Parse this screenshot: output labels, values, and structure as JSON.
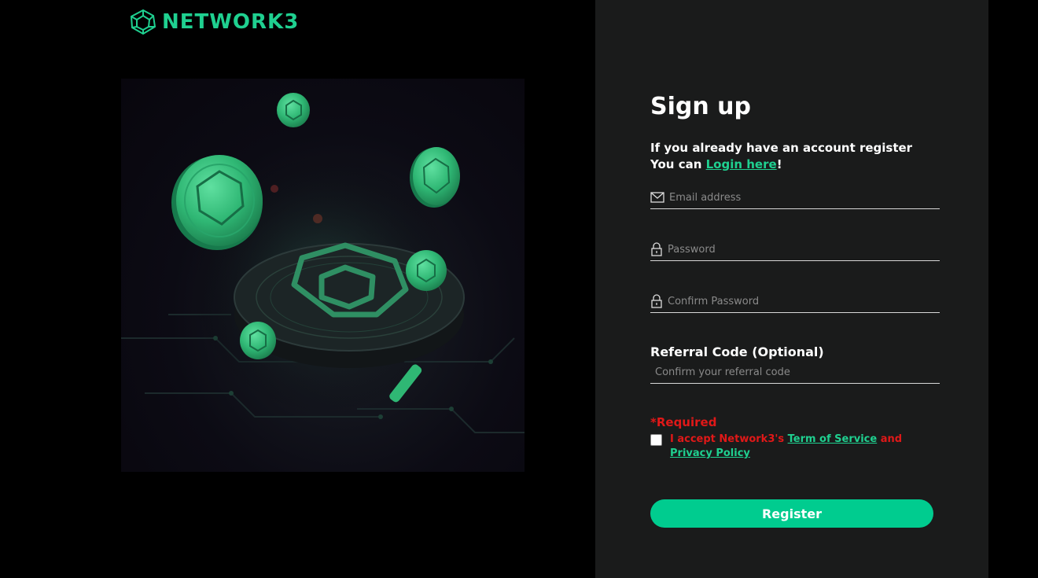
{
  "brand": {
    "name": "NETWORK3",
    "accent": "#1fd090"
  },
  "hero": {
    "image": "coin-network-illustration"
  },
  "form": {
    "title": "Sign up",
    "subtitle_line1": "If you already have an account register",
    "subtitle_prefix": "You can ",
    "login_link": "Login here",
    "subtitle_suffix": "!",
    "email_placeholder": "Email address",
    "password_placeholder": "Password",
    "confirm_placeholder": "Confirm Password",
    "referral_label": "Referral Code (Optional)",
    "referral_placeholder": "Confirm your referral code",
    "required_text": "*Required",
    "terms_prefix": "I accept Network3's ",
    "terms_link": "Term of Service",
    "terms_and": " and ",
    "privacy_link": "Privacy Policy",
    "accepted": false,
    "register_label": "Register",
    "button_color": "#00cc8f",
    "required_color": "#e01818"
  }
}
